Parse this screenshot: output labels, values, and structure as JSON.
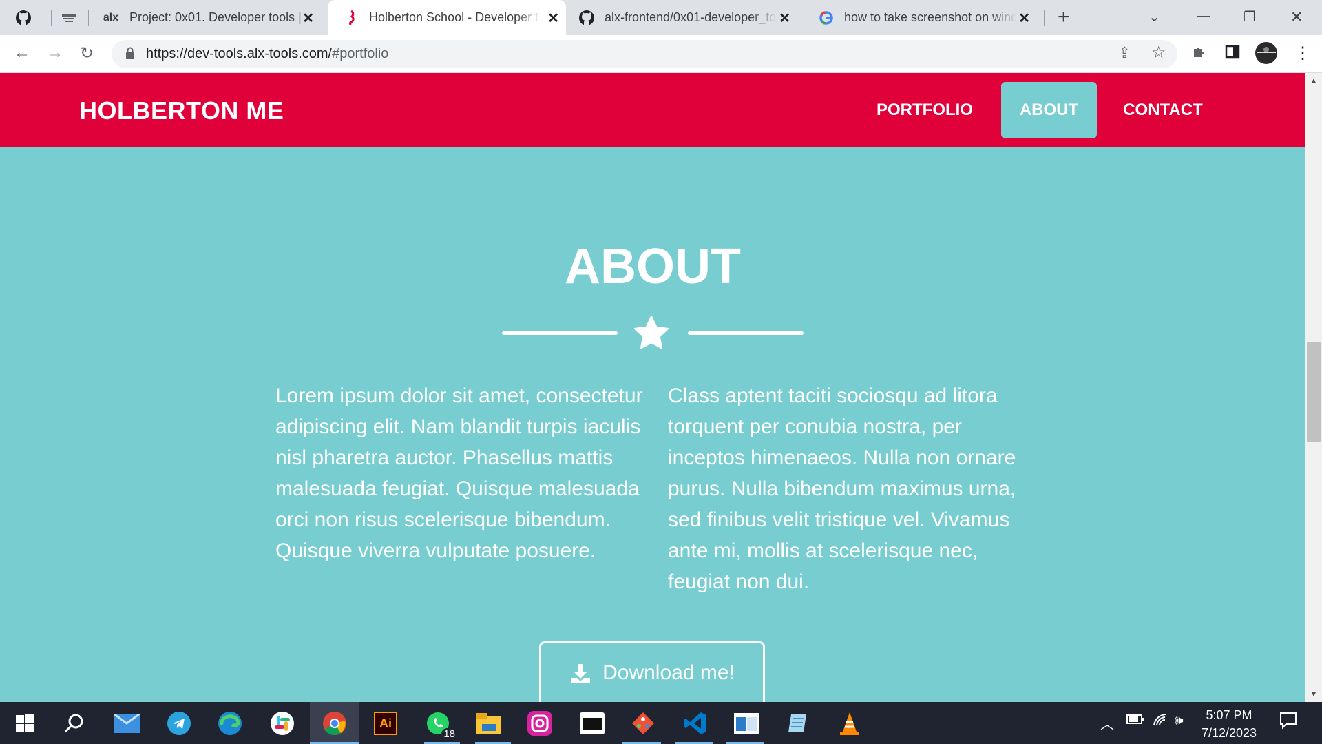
{
  "browser": {
    "tabs": [
      {
        "label": "",
        "icon": "github-icon"
      },
      {
        "label": "",
        "icon": "alx-school-icon"
      },
      {
        "label": "Project: 0x01. Developer tools |",
        "icon": "alx-icon"
      },
      {
        "label": "Holberton School - Developer t",
        "icon": "holberton-icon"
      },
      {
        "label": "alx-frontend/0x01-developer_to",
        "icon": "github-icon"
      },
      {
        "label": "how to take screenshot on wind",
        "icon": "google-icon"
      }
    ],
    "url": {
      "host": "https://dev-tools.alx-tools.com/",
      "path": "#portfolio"
    }
  },
  "page": {
    "brand": "HOLBERTON ME",
    "nav": [
      {
        "label": "PORTFOLIO",
        "active": false
      },
      {
        "label": "ABOUT",
        "active": true
      },
      {
        "label": "CONTACT",
        "active": false
      }
    ],
    "section_title": "ABOUT",
    "paragraphs": [
      "Lorem ipsum dolor sit amet, consectetur adipiscing elit. Nam blandit turpis iaculis nisl pharetra auctor. Phasellus mattis malesuada feugiat. Quisque malesuada orci non risus scelerisque bibendum. Quisque viverra vulputate posuere.",
      "Class aptent taciti sociosqu ad litora torquent per conubia nostra, per inceptos himenaeos. Nulla non ornare purus. Nulla bibendum maximus urna, sed finibus velit tristique vel. Vivamus ante mi, mollis at scelerisque nec, feugiat non dui."
    ],
    "download_label": "Download me!",
    "colors": {
      "navbar": "#e0003a",
      "background": "#78cdd1",
      "text": "#ffffff"
    }
  },
  "taskbar": {
    "apps": [
      "start-icon",
      "search-icon",
      "mail-icon",
      "telegram-icon",
      "edge-icon",
      "slack-icon",
      "chrome-icon",
      "illustrator-icon",
      "whatsapp-icon",
      "file-explorer-icon",
      "instagram-icon",
      "terminal-icon",
      "git-icon",
      "vscode-icon",
      "app-window-icon",
      "notepad-icon",
      "vlc-icon"
    ],
    "whatsapp_badge": "18",
    "illustrator_label": "Ai",
    "time": "5:07 PM",
    "date": "7/12/2023"
  }
}
